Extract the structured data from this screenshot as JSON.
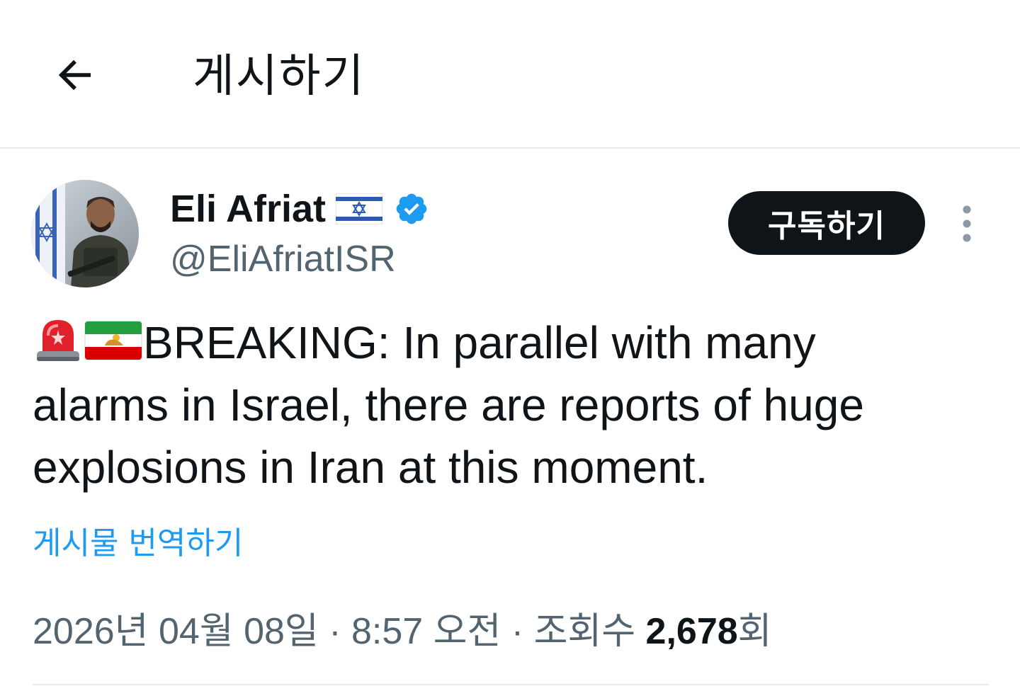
{
  "header": {
    "title": "게시하기",
    "back_icon": "arrow-left-icon"
  },
  "author": {
    "name": "Eli Afriat",
    "handle": "@EliAfriatISR",
    "flag_icon": "israel-flag-icon",
    "verified_icon": "verified-badge-icon",
    "avatar_icon": "avatar-photo"
  },
  "actions": {
    "subscribe_label": "구독하기",
    "more_icon": "more-vertical-icon"
  },
  "tweet": {
    "emoji_1": "police-light-icon",
    "emoji_2": "iran-lion-sun-flag-icon",
    "line_1": "BREAKING: In parallel with many",
    "line_2": "alarms in Israel, there are reports of huge",
    "line_3": "explosions in Iran at this moment.",
    "translate_label": "게시물 번역하기"
  },
  "meta": {
    "date": "2026년 04월 08일",
    "separator_1": " · ",
    "time": "8:57 오전",
    "separator_2": " · ",
    "views_label": "조회수 ",
    "views_count": "2,678",
    "views_suffix": "회"
  },
  "colors": {
    "text": "#0f1419",
    "secondary": "#536471",
    "link": "#1d9bf0",
    "button_bg": "#0f1419",
    "divider": "#e6e9ec"
  }
}
